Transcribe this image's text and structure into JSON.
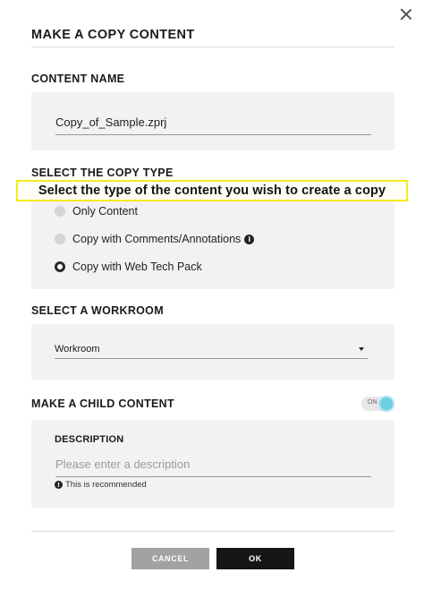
{
  "dialog": {
    "title": "MAKE A COPY CONTENT"
  },
  "content_name": {
    "label": "CONTENT NAME",
    "value": "Copy_of_Sample.zprj"
  },
  "copy_type": {
    "label": "SELECT THE COPY TYPE",
    "callout": "Select the type of the content you wish to create a copy",
    "options": [
      {
        "label": "Only Content",
        "selected": false
      },
      {
        "label": "Copy with Comments/Annotations",
        "selected": false,
        "has_info_icon": true
      },
      {
        "label": "Copy with Web Tech Pack",
        "selected": true
      }
    ]
  },
  "workroom": {
    "label": "SELECT A WORKROOM",
    "selected_value": "Workroom"
  },
  "child_content": {
    "label": "MAKE A CHILD CONTENT",
    "toggle_text": "ON",
    "toggle_on": true,
    "description_label": "DESCRIPTION",
    "description_placeholder": "Please enter a description",
    "hint": "This is recommended"
  },
  "buttons": {
    "cancel": "CANCEL",
    "ok": "OK"
  },
  "colors": {
    "panel_bg": "#f2f2f4",
    "callout_border": "#f5ea1d",
    "toggle_knob": "#6ccfe0",
    "cancel_bg": "#a2a2a2",
    "ok_bg": "#161616"
  }
}
